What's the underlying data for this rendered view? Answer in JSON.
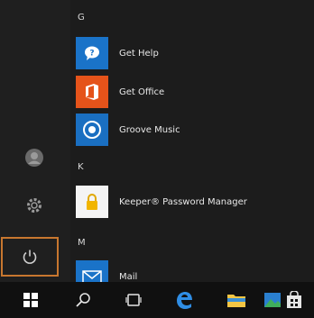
{
  "start_menu": {
    "groups": [
      {
        "letter": "G",
        "apps": [
          {
            "label": "Get Help",
            "icon": "get-help-icon",
            "tile_color": "#1a73c8"
          },
          {
            "label": "Get Office",
            "icon": "office-icon",
            "tile_color": "#e5531a"
          },
          {
            "label": "Groove Music",
            "icon": "groove-music-icon",
            "tile_color": "#1a6fc1"
          }
        ]
      },
      {
        "letter": "K",
        "apps": [
          {
            "label": "Keeper® Password Manager",
            "icon": "keeper-lock-icon",
            "tile_color": "#f4f4f4"
          }
        ]
      },
      {
        "letter": "M",
        "apps": [
          {
            "label": "Mail",
            "icon": "mail-icon",
            "tile_color": "#1a73c8"
          }
        ]
      }
    ],
    "rail": [
      {
        "icon": "user-icon"
      },
      {
        "icon": "settings-gear-icon"
      },
      {
        "icon": "power-icon",
        "highlighted": true,
        "highlight_color": "#c8772f"
      }
    ]
  },
  "taskbar": {
    "items": [
      {
        "icon": "windows-start-icon"
      },
      {
        "icon": "search-icon"
      },
      {
        "icon": "task-view-icon"
      },
      {
        "icon": "edge-browser-icon",
        "color": "#2f8de4"
      },
      {
        "icon": "file-explorer-icon",
        "color": "#f3c544"
      },
      {
        "icon": "photos-icon",
        "color": "#3fae5b"
      },
      {
        "icon": "store-icon"
      }
    ]
  }
}
